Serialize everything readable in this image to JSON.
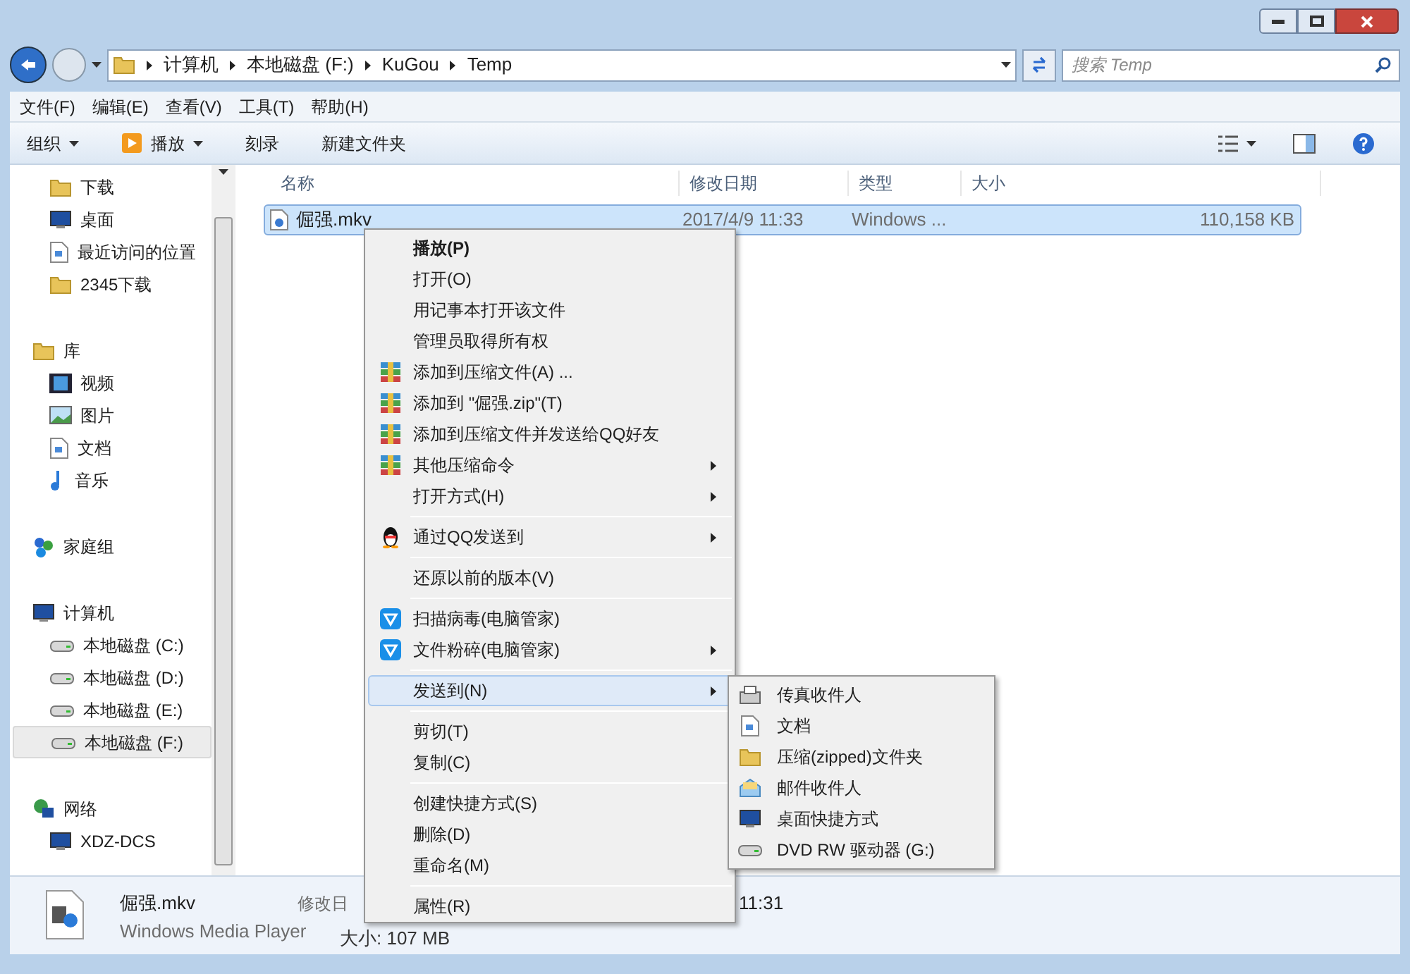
{
  "address_bar": {
    "path": [
      "计算机",
      "本地磁盘 (F:)",
      "KuGou",
      "Temp"
    ]
  },
  "search": {
    "placeholder": "搜索 Temp"
  },
  "menu_bar": [
    "文件(F)",
    "编辑(E)",
    "查看(V)",
    "工具(T)",
    "帮助(H)"
  ],
  "toolbar": [
    {
      "label": "组织",
      "dropdown": true
    },
    {
      "label": "播放",
      "dropdown": true
    },
    {
      "label": "刻录",
      "dropdown": false
    },
    {
      "label": "新建文件夹",
      "dropdown": false
    }
  ],
  "sidebar": {
    "sections": [
      {
        "items": [
          {
            "label": "下载",
            "selected": false
          },
          {
            "label": "桌面",
            "selected": false
          },
          {
            "label": "最近访问的位置",
            "selected": false
          },
          {
            "label": "2345下载",
            "selected": false
          }
        ]
      },
      {
        "label": "库",
        "items": [
          {
            "label": "视频",
            "selected": false
          },
          {
            "label": "图片",
            "selected": false
          },
          {
            "label": "文档",
            "selected": false
          },
          {
            "label": "音乐",
            "selected": false
          }
        ]
      },
      {
        "label": "家庭组"
      },
      {
        "label": "计算机",
        "items": [
          {
            "label": "本地磁盘 (C:)",
            "selected": false
          },
          {
            "label": "本地磁盘 (D:)",
            "selected": false
          },
          {
            "label": "本地磁盘 (E:)",
            "selected": false
          },
          {
            "label": "本地磁盘 (F:)",
            "selected": true
          }
        ]
      },
      {
        "label": "网络",
        "items": [
          {
            "label": "XDZ-DCS",
            "selected": false
          }
        ]
      }
    ]
  },
  "table": {
    "columns": [
      "名称",
      "修改日期",
      "类型",
      "大小"
    ],
    "rows": [
      {
        "name": "倔强.mkv",
        "modified": "2017/4/9 11:33",
        "type": "Windows ...",
        "size": "110,158 KB",
        "selected": true
      }
    ]
  },
  "context_menu": {
    "groups": [
      [
        {
          "label": "播放(P)",
          "default": true,
          "submenu": false,
          "selected": false
        },
        {
          "label": "打开(O)",
          "default": false,
          "submenu": false,
          "selected": false
        },
        {
          "label": "用记事本打开该文件",
          "default": false,
          "submenu": false,
          "selected": false
        },
        {
          "label": "管理员取得所有权",
          "default": false,
          "submenu": false,
          "selected": false
        },
        {
          "label": "添加到压缩文件(A) ...",
          "default": false,
          "submenu": false,
          "selected": false
        },
        {
          "label": "添加到 \"倔强.zip\"(T)",
          "default": false,
          "submenu": false,
          "selected": false
        },
        {
          "label": "添加到压缩文件并发送给QQ好友",
          "default": false,
          "submenu": false,
          "selected": false
        },
        {
          "label": "其他压缩命令",
          "default": false,
          "submenu": true,
          "selected": false
        },
        {
          "label": "打开方式(H)",
          "default": false,
          "submenu": true,
          "selected": false
        }
      ],
      [
        {
          "label": "通过QQ发送到",
          "default": false,
          "submenu": true,
          "selected": false
        }
      ],
      [
        {
          "label": "还原以前的版本(V)",
          "default": false,
          "submenu": false,
          "selected": false
        }
      ],
      [
        {
          "label": "扫描病毒(电脑管家)",
          "default": false,
          "submenu": false,
          "selected": false
        },
        {
          "label": "文件粉碎(电脑管家)",
          "default": false,
          "submenu": true,
          "selected": false
        }
      ],
      [
        {
          "label": "发送到(N)",
          "default": false,
          "submenu": true,
          "selected": true
        }
      ],
      [
        {
          "label": "剪切(T)",
          "default": false,
          "submenu": false,
          "selected": false
        },
        {
          "label": "复制(C)",
          "default": false,
          "submenu": false,
          "selected": false
        }
      ],
      [
        {
          "label": "创建快捷方式(S)",
          "default": false,
          "submenu": false,
          "selected": false
        },
        {
          "label": "删除(D)",
          "default": false,
          "submenu": false,
          "selected": false
        },
        {
          "label": "重命名(M)",
          "default": false,
          "submenu": false,
          "selected": false
        }
      ],
      [
        {
          "label": "属性(R)",
          "default": false,
          "submenu": false,
          "selected": false
        }
      ]
    ]
  },
  "send_to_menu": [
    "传真收件人",
    "文档",
    "压缩(zipped)文件夹",
    "邮件收件人",
    "桌面快捷方式",
    "DVD RW 驱动器 (G:)"
  ],
  "details_pane": {
    "name": "倔强.mkv",
    "app": "Windows Media Player",
    "modified_label": "修改日",
    "modified_time": "11:31",
    "size": "大小: 107 MB"
  }
}
